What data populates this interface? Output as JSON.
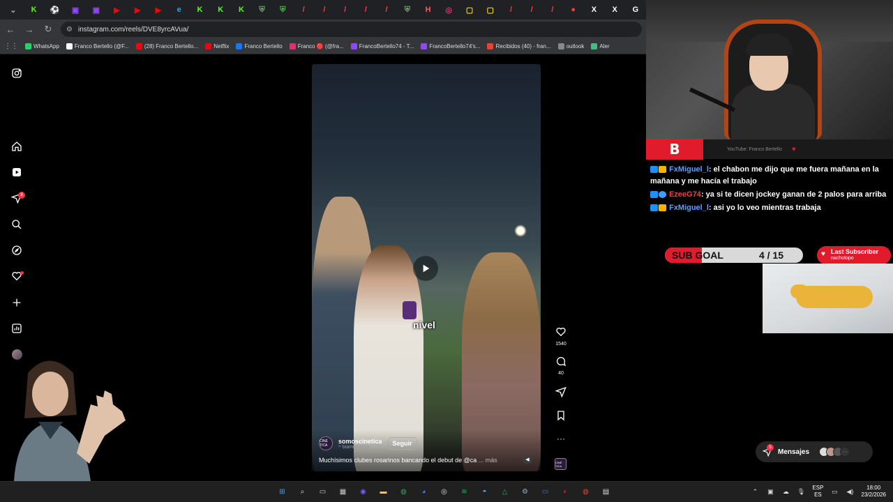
{
  "browser": {
    "url": "instagram.com/reels/DVE8yrcAVua/",
    "tabs": [
      {
        "icon": "chevron-down-icon",
        "color": "#aaaaaa",
        "glyph": "⌄"
      },
      {
        "icon": "kick-icon",
        "color": "#53fc18",
        "glyph": "K"
      },
      {
        "icon": "soccer-icon",
        "color": "#ffffff",
        "glyph": "⚽"
      },
      {
        "icon": "twitch-icon",
        "color": "#9146ff",
        "glyph": "▣"
      },
      {
        "icon": "twitch-icon",
        "color": "#9146ff",
        "glyph": "▣"
      },
      {
        "icon": "youtube-icon",
        "color": "#ff0000",
        "glyph": "▶"
      },
      {
        "icon": "youtube-icon",
        "color": "#ff0000",
        "glyph": "▶"
      },
      {
        "icon": "youtube-icon",
        "color": "#ff0000",
        "glyph": "▶"
      },
      {
        "icon": "edge-icon",
        "color": "#2aa5e0",
        "glyph": "e"
      },
      {
        "icon": "kick-icon",
        "color": "#53fc18",
        "glyph": "K"
      },
      {
        "icon": "kick-icon",
        "color": "#53fc18",
        "glyph": "K"
      },
      {
        "icon": "kick-icon",
        "color": "#53fc18",
        "glyph": "K"
      },
      {
        "icon": "shield-icon",
        "color": "#6fa86f",
        "glyph": "⛨"
      },
      {
        "icon": "shield-icon",
        "color": "#3fbf3f",
        "glyph": "⛨"
      },
      {
        "icon": "slash-icon",
        "color": "#ff3b3b",
        "glyph": "/"
      },
      {
        "icon": "slash-icon",
        "color": "#ff3b3b",
        "glyph": "/"
      },
      {
        "icon": "slash-icon",
        "color": "#ff3b3b",
        "glyph": "/"
      },
      {
        "icon": "slash-icon",
        "color": "#ff3b3b",
        "glyph": "/"
      },
      {
        "icon": "slash-icon",
        "color": "#ff3b3b",
        "glyph": "/"
      },
      {
        "icon": "shield-icon",
        "color": "#6fa86f",
        "glyph": "⛨"
      },
      {
        "icon": "hash-icon",
        "color": "#ff5a5a",
        "glyph": "H"
      },
      {
        "icon": "instagram-icon",
        "color": "#e1306c",
        "glyph": "◎"
      },
      {
        "icon": "app-icon",
        "color": "#f5d90a",
        "glyph": "▢"
      },
      {
        "icon": "app-icon",
        "color": "#f5d90a",
        "glyph": "▢"
      },
      {
        "icon": "slash-icon",
        "color": "#ff3b3b",
        "glyph": "/"
      },
      {
        "icon": "slash-icon",
        "color": "#ff3b3b",
        "glyph": "/"
      },
      {
        "icon": "slash-icon",
        "color": "#ff3b3b",
        "glyph": "/"
      },
      {
        "icon": "record-icon",
        "color": "#ff3b3b",
        "glyph": "●"
      },
      {
        "icon": "x-icon",
        "color": "#ffffff",
        "glyph": "X"
      },
      {
        "icon": "x-icon",
        "color": "#ffffff",
        "glyph": "X"
      },
      {
        "icon": "google-icon",
        "color": "#ffffff",
        "glyph": "G"
      }
    ],
    "bookmarks": [
      {
        "label": "WhatsApp",
        "color": "#25d366"
      },
      {
        "label": "Franco Bertello (@F...",
        "color": "#ffffff"
      },
      {
        "label": "(28) Franco Bertello...",
        "color": "#ff0000"
      },
      {
        "label": "Netflix",
        "color": "#e50914"
      },
      {
        "label": "Franco Bertello",
        "color": "#1877f2"
      },
      {
        "label": "Franco 🔴 (@fra...",
        "color": "#e1306c"
      },
      {
        "label": "FrancoBertello74 - T...",
        "color": "#9146ff"
      },
      {
        "label": "FrancoBertello74's...",
        "color": "#9146ff"
      },
      {
        "label": "Recibidos (40) - fran...",
        "color": "#ea4335"
      },
      {
        "label": "outlook",
        "color": "#888888"
      },
      {
        "label": "Aler",
        "color": "#3fbf7f"
      }
    ]
  },
  "sidebar": {
    "items": [
      "instagram-icon",
      "home-icon",
      "reels-icon",
      "messages-icon",
      "search-icon",
      "explore-icon",
      "heart-icon",
      "create-icon",
      "dashboard-icon",
      "profile-icon"
    ],
    "messages_badge": "8"
  },
  "reel": {
    "caption_word": "nivel",
    "account_name": "somoscinetica",
    "account_avatar": "CINÉ TICA",
    "account_sub": "ᴖ biamigliazzo",
    "follow_label": "Seguir",
    "description": "Muchísimos clubes rosarinos bancando el debut de @ca",
    "more_label": "... más",
    "likes": "1540",
    "comments": "40",
    "audio_thumb": "CINÉ TICA"
  },
  "messages": {
    "label": "Mensajes",
    "badge": "5"
  },
  "stream": {
    "logo": "B",
    "yt_label": "YouTube: Franco Bertello",
    "chat": [
      {
        "user": "FxMiguel_l",
        "user_class": "user-blue",
        "badge": "crown",
        "text": ": el chabon me dijo que me fuera mañana en la mañana y me hacía el trabajo"
      },
      {
        "user": "EzeeG74",
        "user_class": "user-red",
        "badge": "gem",
        "text": ": ya si te dicen jockey ganan de 2 palos para arriba"
      },
      {
        "user": "FxMiguel_l",
        "user_class": "user-blue",
        "badge": "crown",
        "text": ": asi yo lo veo mientras trabaja"
      }
    ],
    "sub_goal_label": "SUB GOAL",
    "sub_goal_count": "4 / 15",
    "sub_goal_progress": 0.27,
    "last_sub_title": "Last Subscriber",
    "last_sub_name": "nachotopo"
  },
  "taskbar": {
    "apps": [
      {
        "icon": "windows-icon",
        "color": "#3aa0ff",
        "glyph": "⊞"
      },
      {
        "icon": "search-icon",
        "color": "#dddddd",
        "glyph": "⌕"
      },
      {
        "icon": "task-view-icon",
        "color": "#cccccc",
        "glyph": "▭"
      },
      {
        "icon": "store-icon",
        "color": "#cccccc",
        "glyph": "▦"
      },
      {
        "icon": "app-icon",
        "color": "#7c5cff",
        "glyph": "◉"
      },
      {
        "icon": "folder-icon",
        "color": "#f5c84a",
        "glyph": "▬"
      },
      {
        "icon": "chrome-icon",
        "color": "#34a853",
        "glyph": "◍"
      },
      {
        "icon": "discord-icon",
        "color": "#5865f2",
        "glyph": "◕"
      },
      {
        "icon": "obs-icon",
        "color": "#dddddd",
        "glyph": "◎"
      },
      {
        "icon": "spotify-icon",
        "color": "#1db954",
        "glyph": "≋"
      },
      {
        "icon": "steam-icon",
        "color": "#66c0f4",
        "glyph": "◓"
      },
      {
        "icon": "drive-icon",
        "color": "#34a853",
        "glyph": "△"
      },
      {
        "icon": "app-icon",
        "color": "#9ab",
        "glyph": "⚙"
      },
      {
        "icon": "monitor-icon",
        "color": "#3a7bd5",
        "glyph": "▭"
      },
      {
        "icon": "app-icon",
        "color": "#e21b2c",
        "glyph": "◐"
      },
      {
        "icon": "chrome-icon",
        "color": "#ea4335",
        "glyph": "◍"
      },
      {
        "icon": "calculator-icon",
        "color": "#dddddd",
        "glyph": "▤"
      }
    ],
    "lang_top": "ESP",
    "lang_bottom": "ES",
    "time": "18:00",
    "date": "23/2/2026"
  }
}
